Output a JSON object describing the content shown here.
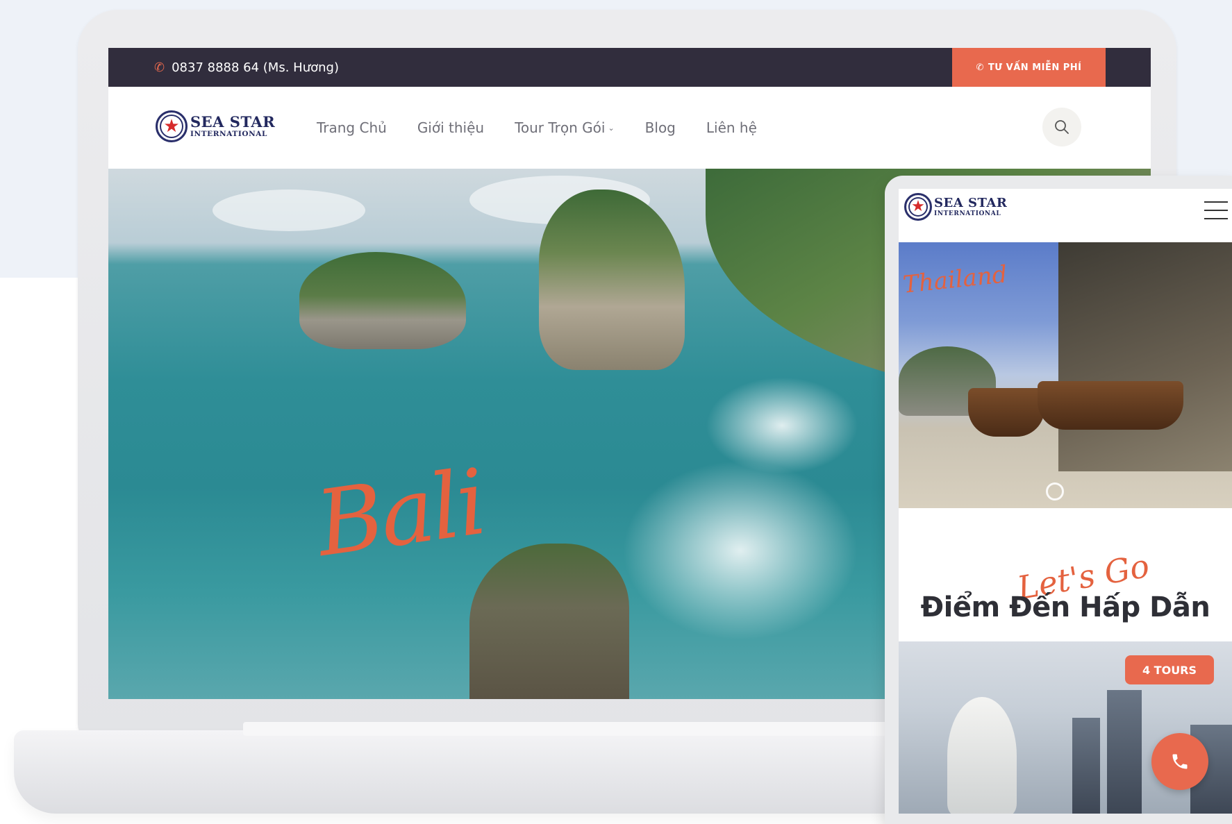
{
  "desktop": {
    "topbar": {
      "phone_icon": "phone-ring-icon",
      "phone_text": "0837 8888 64 (Ms. Hương)",
      "cta_icon": "phone-ring-icon",
      "cta_label": "TƯ VẤN MIỄN PHÍ"
    },
    "logo": {
      "line1": "SEA STAR",
      "line2": "INTERNATIONAL"
    },
    "nav": {
      "items": [
        {
          "label": "Trang Chủ"
        },
        {
          "label": "Giới thiệu"
        },
        {
          "label": "Tour Trọn Gói"
        },
        {
          "label": "Blog"
        },
        {
          "label": "Liên hệ"
        }
      ],
      "search_icon": "search-icon"
    },
    "hero": {
      "script_text": "Bali"
    }
  },
  "mobile": {
    "logo": {
      "line1": "SEA STAR",
      "line2": "INTERNATIONAL"
    },
    "menu_icon": "hamburger-icon",
    "slide": {
      "script_text": "Thailand"
    },
    "section": {
      "script_text": "Let's Go",
      "title": "Điểm Đến Hấp Dẫn"
    },
    "card": {
      "badge": "4 TOURS"
    },
    "call_icon": "phone-icon"
  },
  "colors": {
    "accent": "#e8694e",
    "topbar": "#312d3d",
    "brand_navy": "#22285e",
    "logo_star": "#d62b2b"
  }
}
